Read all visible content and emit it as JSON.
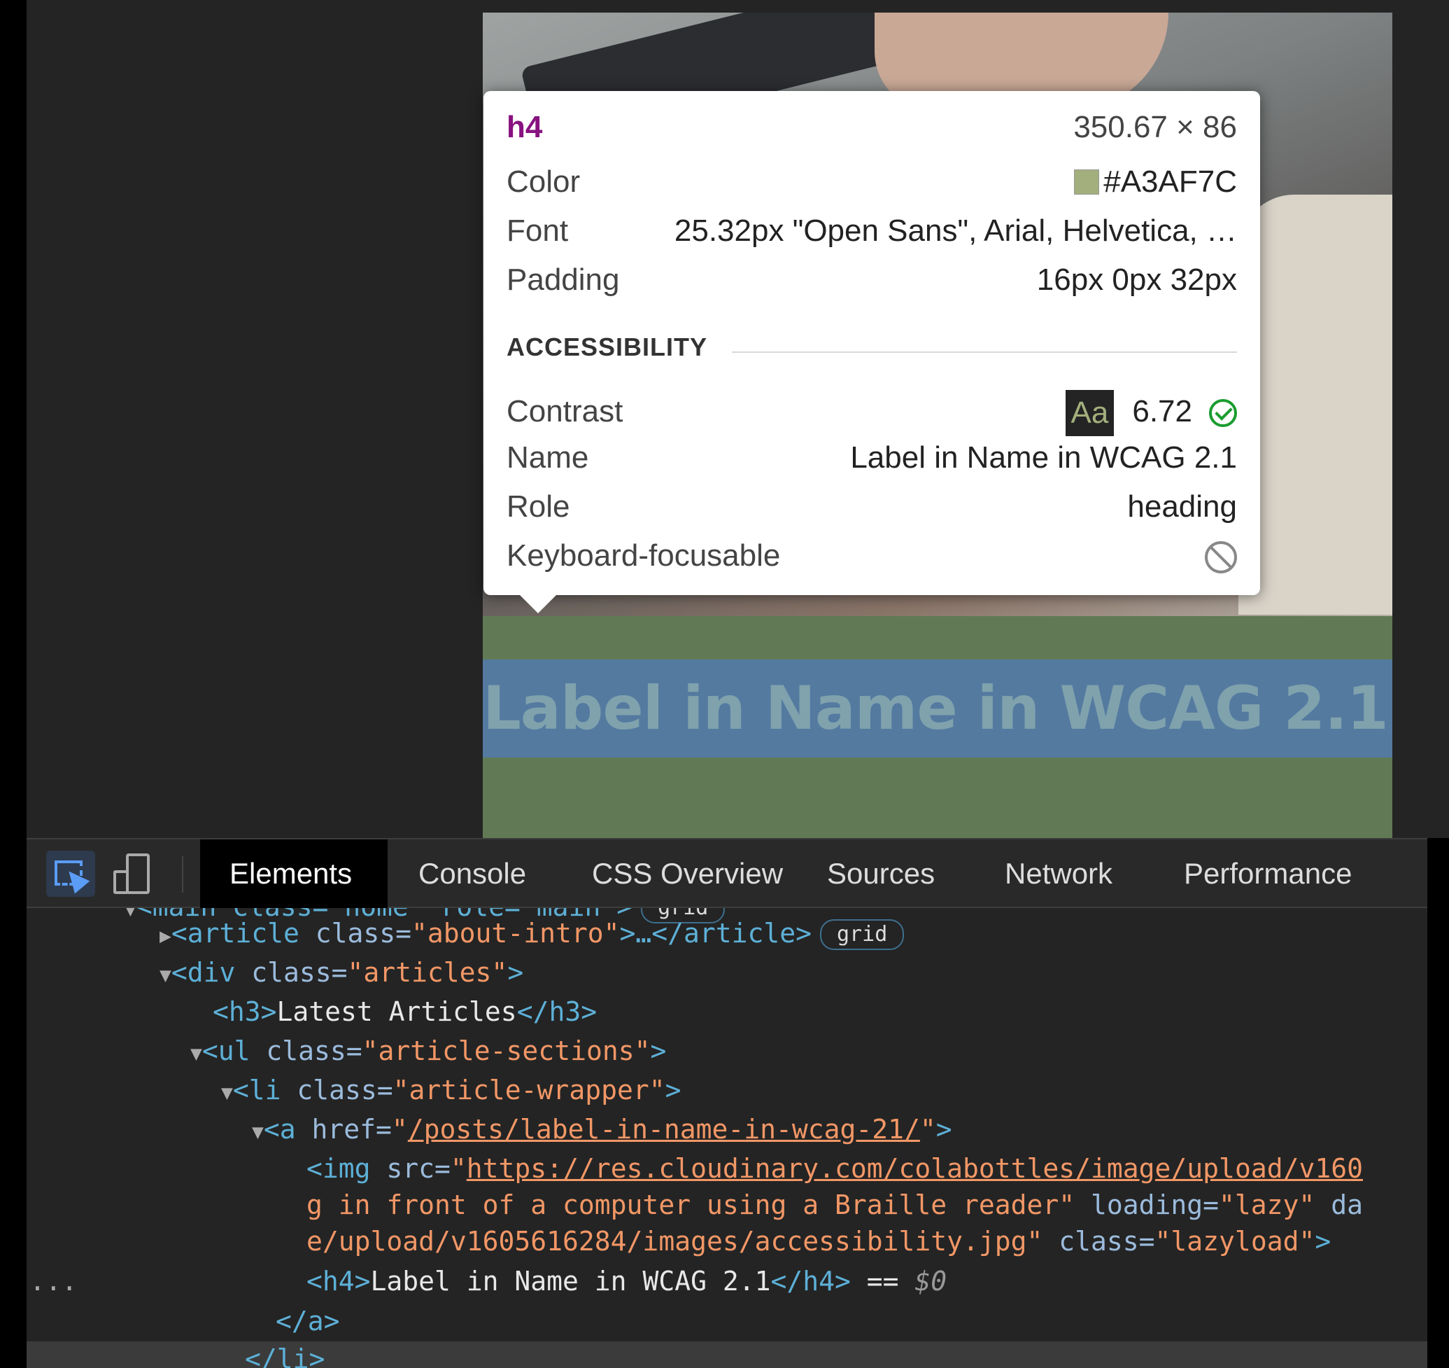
{
  "tooltip": {
    "tag": "h4",
    "size": "350.67 × 86",
    "color_label": "Color",
    "color_value": "#A3AF7C",
    "font_label": "Font",
    "font_value": "25.32px \"Open Sans\", Arial, Helvetica, …",
    "padding_label": "Padding",
    "padding_value": "16px 0px 32px",
    "section_label": "ACCESSIBILITY",
    "contrast_label": "Contrast",
    "contrast_sample": "Aa",
    "contrast_value": "6.72",
    "name_label": "Name",
    "name_value": "Label in Name in WCAG 2.1",
    "role_label": "Role",
    "role_value": "heading",
    "focusable_label": "Keyboard-focusable"
  },
  "page": {
    "heading": "Label in Name in WCAG 2.1"
  },
  "devtools": {
    "tabs": [
      "Elements",
      "Console",
      "CSS Overview",
      "Sources",
      "Network",
      "Performance"
    ],
    "active_tab": "Elements"
  },
  "dom": {
    "line0": "<main class=\"home\" role=\"main\">",
    "badge0": "grid",
    "line1_tag_open": "<article",
    "line1_attr": " class=",
    "line1_val": "\"about-intro\"",
    "line1_rest": ">…</article>",
    "badge1": "grid",
    "line2_tag_open": "<div",
    "line2_attr": " class=",
    "line2_val": "\"articles\"",
    "line2_close": ">",
    "line3_open": "<h3>",
    "line3_text": "Latest Articles",
    "line3_close": "</h3>",
    "line4_tag_open": "<ul",
    "line4_attr": " class=",
    "line4_val": "\"article-sections\"",
    "line4_close": ">",
    "line5_tag_open": "<li",
    "line5_attr": " class=",
    "line5_val": "\"article-wrapper\"",
    "line5_close": ">",
    "line6_tag_open": "<a",
    "line6_attr": " href=",
    "line6_q1": "\"",
    "line6_val": "/posts/label-in-name-in-wcag-21/",
    "line6_q2": "\"",
    "line6_close": ">",
    "line7_tag_open": "<img",
    "line7_attr": " src=",
    "line7_q": "\"",
    "line7_val": "https://res.cloudinary.com/colabottles/image/upload/v160",
    "line8_val": "g in front of a computer using a Braille reader\"",
    "line8_attr": " loading=",
    "line8_val2": "\"lazy\"",
    "line8_attr2": " da",
    "line9_val": "e/upload/v1605616284/images/accessibility.jpg\"",
    "line9_attr": " class=",
    "line9_val2": "\"lazyload\"",
    "line9_close": ">",
    "line10_open": "<h4>",
    "line10_text": "Label in Name in WCAG 2.1",
    "line10_close": "</h4>",
    "line10_eq": " == ",
    "line10_ref": "$0",
    "line11": "</a>",
    "line12": "</li>",
    "ellipsis": "..."
  }
}
